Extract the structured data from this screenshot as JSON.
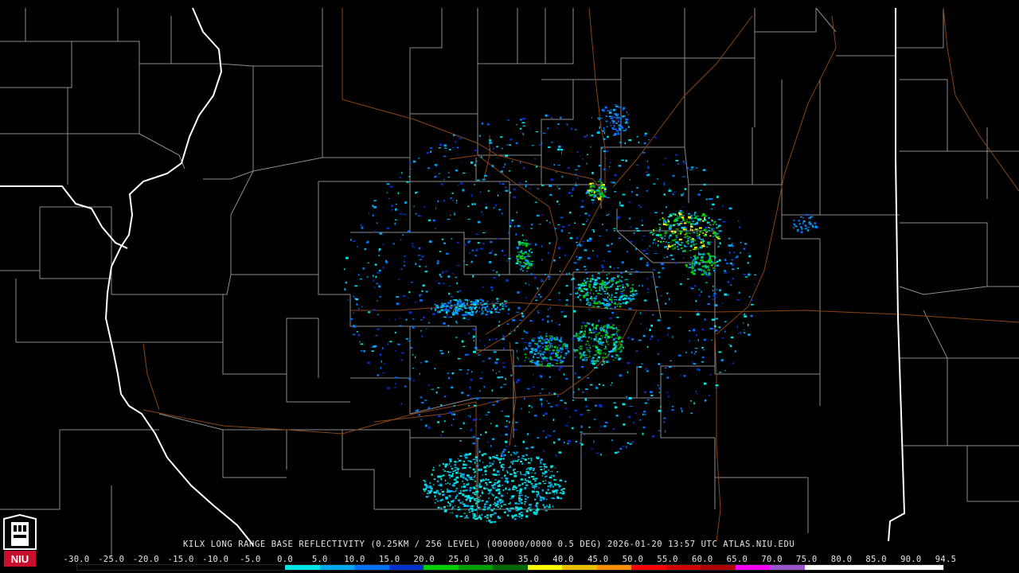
{
  "caption": "KILX LONG RANGE BASE REFLECTIVITY (0.25KM / 256 LEVEL) (000000/0000 0.5 DEG) 2026-01-20 13:57 UTC  ATLAS.NIU.EDU",
  "logo": {
    "text": "NIU",
    "icon": "niu-logo-icon"
  },
  "scale": {
    "labels": [
      "-30.0",
      "-25.0",
      "-20.0",
      "-15.0",
      "-10.0",
      "-5.0",
      "0.0",
      "5.0",
      "10.0",
      "15.0",
      "20.0",
      "25.0",
      "30.0",
      "35.0",
      "40.0",
      "45.0",
      "50.0",
      "55.0",
      "60.0",
      "65.0",
      "70.0",
      "75.0",
      "80.0",
      "85.0",
      "90.0",
      "94.5"
    ],
    "colors": [
      "#000000",
      "#000000",
      "#000000",
      "#000000",
      "#000000",
      "#000000",
      "#00e6e6",
      "#00aaee",
      "#0070ff",
      "#0030d0",
      "#00d000",
      "#00a000",
      "#006800",
      "#ffff00",
      "#e8c000",
      "#ff9000",
      "#ff0000",
      "#d00000",
      "#b00000",
      "#ff00ff",
      "#9955cc",
      "#ffffff",
      "#ffffff",
      "#ffffff",
      "#ffffff"
    ]
  },
  "colors": {
    "state_border": "#ffffff",
    "county_border": "#8c8c8c",
    "highway": "#8b4513"
  }
}
